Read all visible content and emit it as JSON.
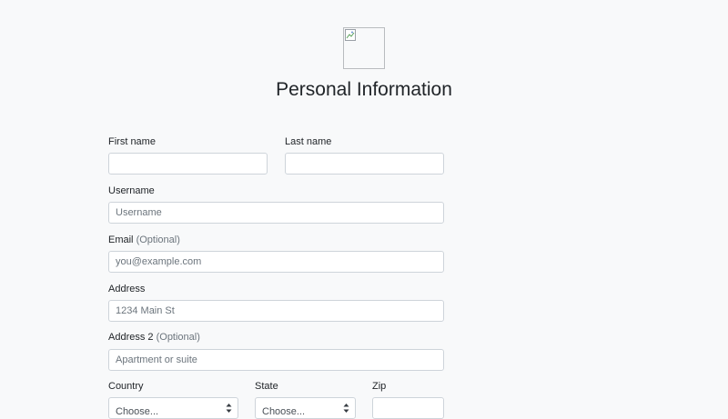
{
  "header": {
    "title": "Personal Information",
    "logo_icon": "broken-image-icon"
  },
  "form": {
    "first_name": {
      "label": "First name",
      "value": "",
      "placeholder": ""
    },
    "last_name": {
      "label": "Last name",
      "value": "",
      "placeholder": ""
    },
    "username": {
      "label": "Username",
      "value": "",
      "placeholder": "Username"
    },
    "email": {
      "label": "Email",
      "optional": "(Optional)",
      "value": "",
      "placeholder": "you@example.com"
    },
    "address": {
      "label": "Address",
      "value": "",
      "placeholder": "1234 Main St"
    },
    "address2": {
      "label": "Address 2",
      "optional": "(Optional)",
      "value": "",
      "placeholder": "Apartment or suite"
    },
    "country": {
      "label": "Country",
      "selected": "Choose..."
    },
    "state": {
      "label": "State",
      "selected": "Choose..."
    },
    "zip": {
      "label": "Zip",
      "value": "",
      "placeholder": ""
    }
  },
  "colors": {
    "background": "#f8f9fa",
    "text": "#212529",
    "muted": "#6c757d",
    "border": "#ced4da"
  }
}
